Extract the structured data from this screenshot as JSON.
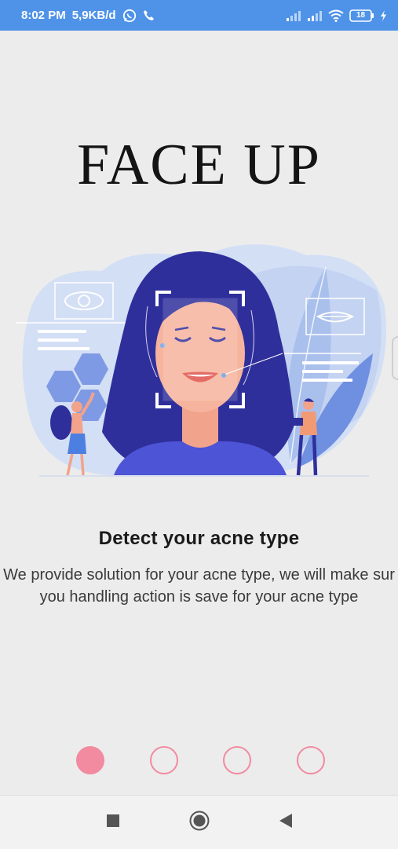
{
  "status_bar": {
    "time": "8:02 PM",
    "network_speed": "5,9KB/d",
    "battery_level": "18",
    "icons": [
      "whatsapp-icon",
      "phone-icon",
      "signal-icon",
      "signal-icon",
      "wifi-icon",
      "battery-icon",
      "charging-icon"
    ]
  },
  "app": {
    "title": "FACE UP"
  },
  "onboarding": {
    "headline": "Detect your acne type",
    "description_line1": "We provide solution for your acne type, we will make sur",
    "description_line2": "you handling action is save for your acne type",
    "page_count": 4,
    "current_page": 1
  },
  "navigation_bar": {
    "buttons": [
      "recents-square-icon",
      "home-circle-icon",
      "back-triangle-icon"
    ]
  },
  "colors": {
    "status_bar": "#4f93e8",
    "accent_pink": "#f28aa0",
    "background": "#ececec",
    "illustration_blue": "#2f2f9c",
    "illustration_light": "#c9d8f3"
  }
}
